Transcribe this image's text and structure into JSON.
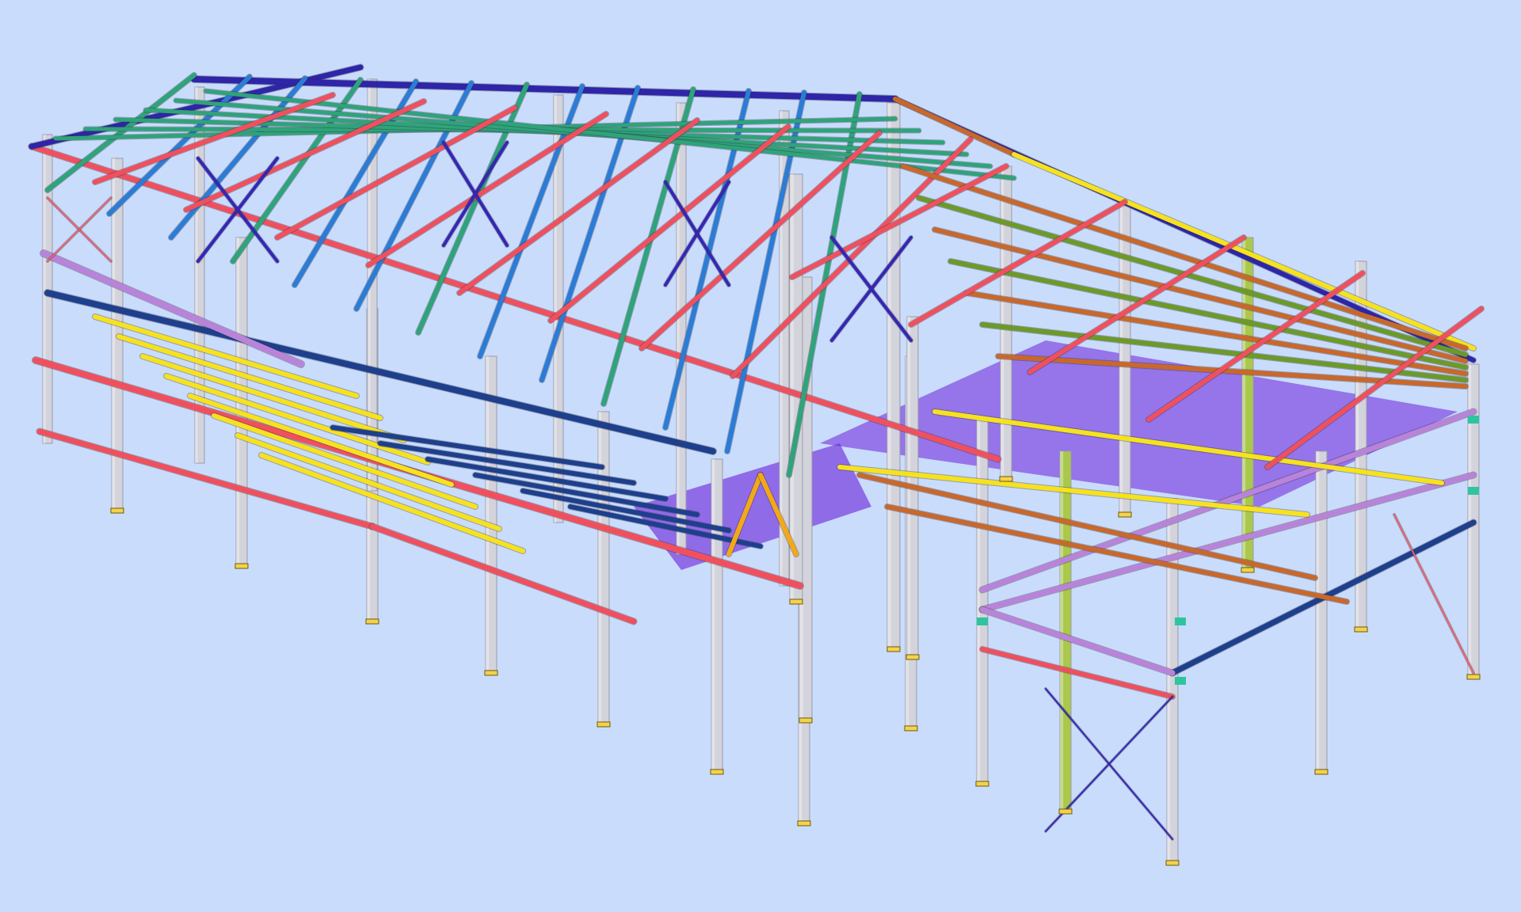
{
  "viewport": {
    "background": "#c9dcfc"
  },
  "palette": {
    "column": "#d3d3dc",
    "column_shade": "#9a9aaa",
    "rafter": "#f0505e",
    "roof_beam": "#2b7cd6",
    "purlin_green": "#2fa37a",
    "purlin_olive": "#6c9a2a",
    "eave": "#2e25a8",
    "floor_beam": "#1e3f8c",
    "joist": "#f6e21e",
    "tie_beam": "#b983d9",
    "brace": "#3526b5",
    "brace_light": "#dede7a",
    "cable": "#f06070",
    "orange": "#c8682c",
    "floor_deck": "#6a20d8",
    "stair": "#f3a818",
    "lime_column": "#a9c84c",
    "teal": "#2ec4a0",
    "base_plate": "#f5d24a"
  },
  "legend_notes": {
    "icons": [
      "column-shape",
      "beam-shape",
      "brace-shape",
      "base-plate-shape"
    ]
  }
}
